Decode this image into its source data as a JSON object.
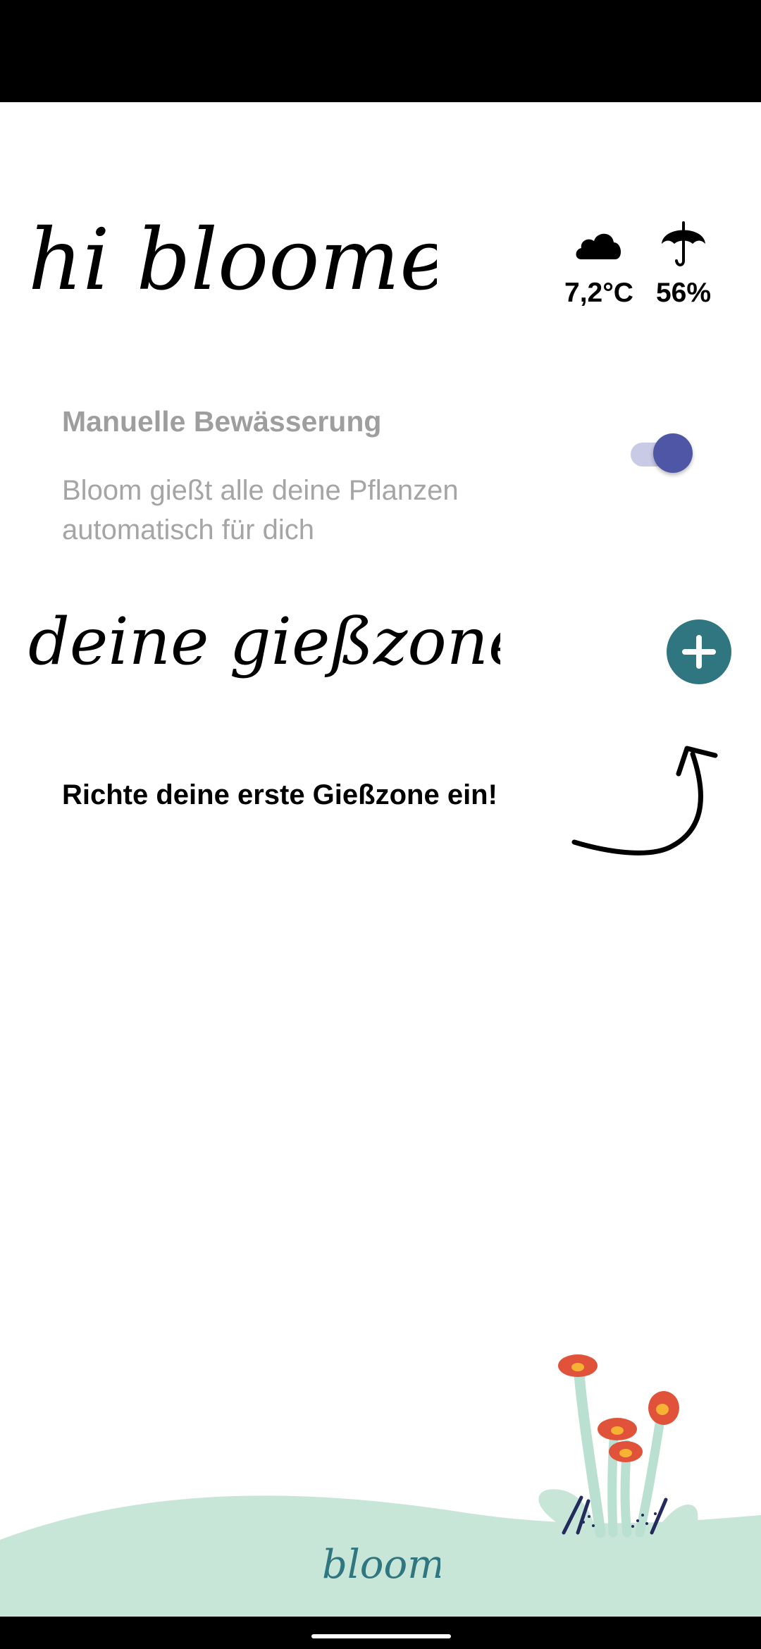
{
  "greeting": "hi bloomer",
  "weather": {
    "temperature": "7,2°C",
    "temperature_icon": "cloud-icon",
    "rain_chance": "56%",
    "rain_icon": "umbrella-icon"
  },
  "manual_watering": {
    "title": "Manuelle Bewässerung",
    "description": "Bloom gießt alle deine Pflanzen automatisch für dich",
    "enabled": true
  },
  "zones": {
    "heading": "deine gießzonen",
    "add_icon": "plus-icon",
    "empty_hint": "Richte deine erste Gießzone ein!"
  },
  "brand": {
    "logo": "bloom",
    "accent_color": "#2f7680",
    "toggle_color": "#5056a6",
    "footer_color": "#c8e6d8"
  }
}
